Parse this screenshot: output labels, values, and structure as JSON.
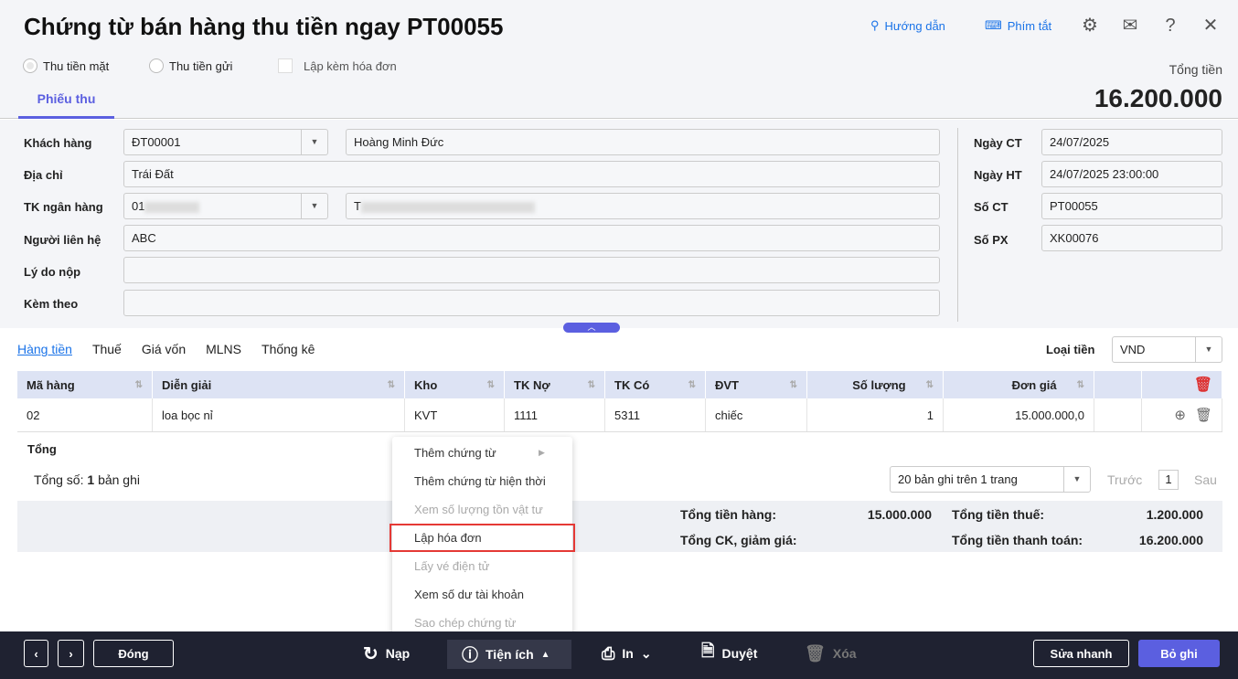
{
  "header": {
    "title": "Chứng từ bán hàng thu tiền ngay PT00055",
    "guide": "Hướng dẫn",
    "shortcuts": "Phím tắt",
    "total_label": "Tổng tiền",
    "total_value": "16.200.000"
  },
  "options": {
    "cash": "Thu tiền mặt",
    "deposit": "Thu tiền gửi",
    "invoice": "Lập kèm hóa đơn"
  },
  "tab": "Phiếu thu",
  "form": {
    "customer_label": "Khách hàng",
    "customer_code": "ĐT00001",
    "customer_name": "Hoàng Minh Đức",
    "address_label": "Địa chỉ",
    "address": "Trái Đất",
    "bank_label": "TK ngân hàng",
    "bank_account": "01",
    "bank_name": "T",
    "contact_label": "Người liên hệ",
    "contact": "ABC",
    "reason_label": "Lý do nộp",
    "reason": "",
    "attach_label": "Kèm theo",
    "attach": "",
    "date_label": "Ngày CT",
    "date": "24/07/2025",
    "post_label": "Ngày HT",
    "post": "24/07/2025 23:00:00",
    "no_label": "Số CT",
    "no": "PT00055",
    "px_label": "Số PX",
    "px": "XK00076"
  },
  "detail_tabs": [
    "Hàng tiền",
    "Thuế",
    "Giá vốn",
    "MLNS",
    "Thống kê"
  ],
  "currency_label": "Loại tiền",
  "currency": "VND",
  "table": {
    "headers": [
      "Mã hàng",
      "Diễn giải",
      "Kho",
      "TK Nợ",
      "TK Có",
      "ĐVT",
      "Số lượng",
      "Đơn giá"
    ],
    "rows": [
      [
        "02",
        "loa bọc nỉ",
        "KVT",
        "1111",
        "5311",
        "chiếc",
        "1",
        "15.000.000,0"
      ]
    ],
    "total_label": "Tổng",
    "count_label": "Tổng số:",
    "count": "1",
    "count_suffix": "bản ghi"
  },
  "pager": {
    "size": "20 bản ghi trên 1 trang",
    "prev": "Trước",
    "page": "1",
    "next": "Sau"
  },
  "summary": {
    "goods_label": "Tổng tiền hàng:",
    "goods": "15.000.000",
    "discount_label": "Tổng CK, giảm giá:",
    "tax_label": "Tổng tiền thuế:",
    "tax": "1.200.000",
    "pay_label": "Tổng tiền thanh toán:",
    "pay": "16.200.000"
  },
  "menu": [
    {
      "label": "Thêm chứng từ",
      "disabled": false
    },
    {
      "label": "Thêm chứng từ hiện thời",
      "disabled": false
    },
    {
      "label": "Xem số lượng tồn vật tư",
      "disabled": true
    },
    {
      "label": "Lập hóa đơn",
      "disabled": false
    },
    {
      "label": "Lấy vé điện tử",
      "disabled": true
    },
    {
      "label": "Xem số dư tài khoản",
      "disabled": false
    },
    {
      "label": "Sao chép chứng từ",
      "disabled": true
    }
  ],
  "footer": {
    "close": "Đóng",
    "reload": "Nạp",
    "utilities": "Tiện ích",
    "print": "In",
    "approve": "Duyệt",
    "delete": "Xóa",
    "quick_edit": "Sửa nhanh",
    "save": "Bỏ ghi"
  }
}
